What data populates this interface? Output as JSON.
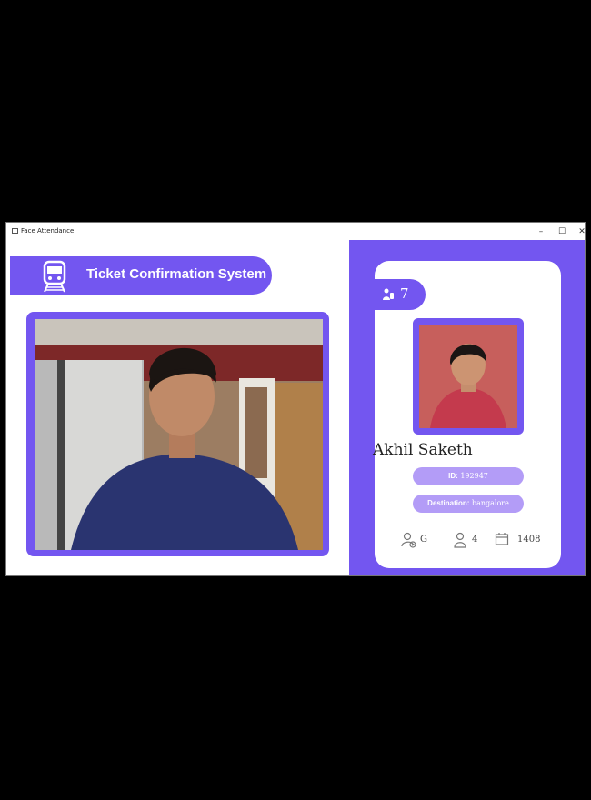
{
  "window": {
    "title": "Face Attendance",
    "controls": [
      "–",
      "☐",
      "✕"
    ]
  },
  "header": {
    "title": "Ticket Confirmation System",
    "icon": "train-icon"
  },
  "camera": {
    "icon": "webcam-feed"
  },
  "card": {
    "count": "7",
    "name": "Akhil Saketh",
    "id_label": "ID:",
    "id_value": "192947",
    "destination_label": "Destination:",
    "destination_value": "bangalore",
    "stats": {
      "group": "G",
      "persons": "4",
      "date": "1408"
    }
  },
  "colors": {
    "accent": "#7356f0",
    "pill": "#b39cf7"
  }
}
